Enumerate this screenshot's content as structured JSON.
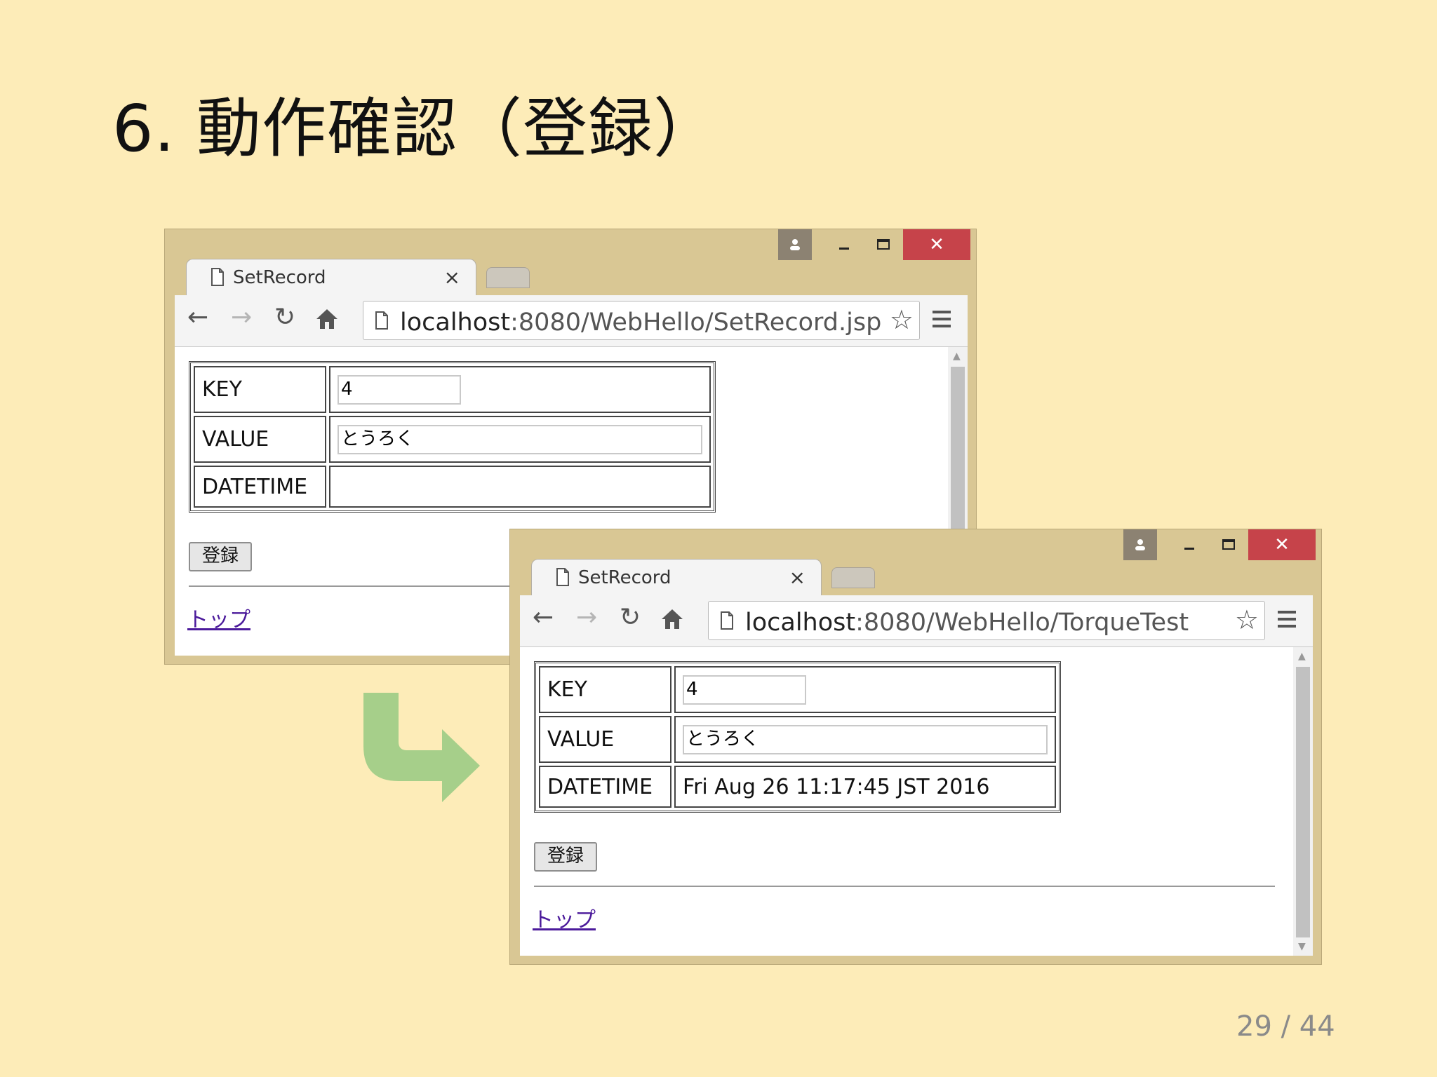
{
  "slide": {
    "title": "6. 動作確認（登録）",
    "page_number": "29 / 44"
  },
  "browser_before": {
    "tab_title": "SetRecord",
    "url_host": "localhost",
    "url_rest": ":8080/WebHello/SetRecord.jsp",
    "form": {
      "key_label": "KEY",
      "key_value": "4",
      "value_label": "VALUE",
      "value_value": "とうろく",
      "datetime_label": "DATETIME",
      "datetime_value": ""
    },
    "submit_label": "登録",
    "link_label": "トップ"
  },
  "browser_after": {
    "tab_title": "SetRecord",
    "url_host": "localhost",
    "url_rest": ":8080/WebHello/TorqueTest",
    "form": {
      "key_label": "KEY",
      "key_value": "4",
      "value_label": "VALUE",
      "value_value": "とうろく",
      "datetime_label": "DATETIME",
      "datetime_value": "Fri Aug 26 11:17:45 JST 2016"
    },
    "submit_label": "登録",
    "link_label": "トップ"
  },
  "colors": {
    "background": "#fdecb8",
    "window_frame": "#d9c794",
    "close_button": "#c6434a",
    "arrow": "#a6cf8a",
    "link": "#4b1a9b"
  },
  "icons": [
    "user-icon",
    "minimize-icon",
    "maximize-icon",
    "close-icon",
    "page-icon",
    "back-arrow-icon",
    "forward-arrow-icon",
    "reload-icon",
    "home-icon",
    "star-icon",
    "menu-icon",
    "transition-arrow-icon"
  ]
}
